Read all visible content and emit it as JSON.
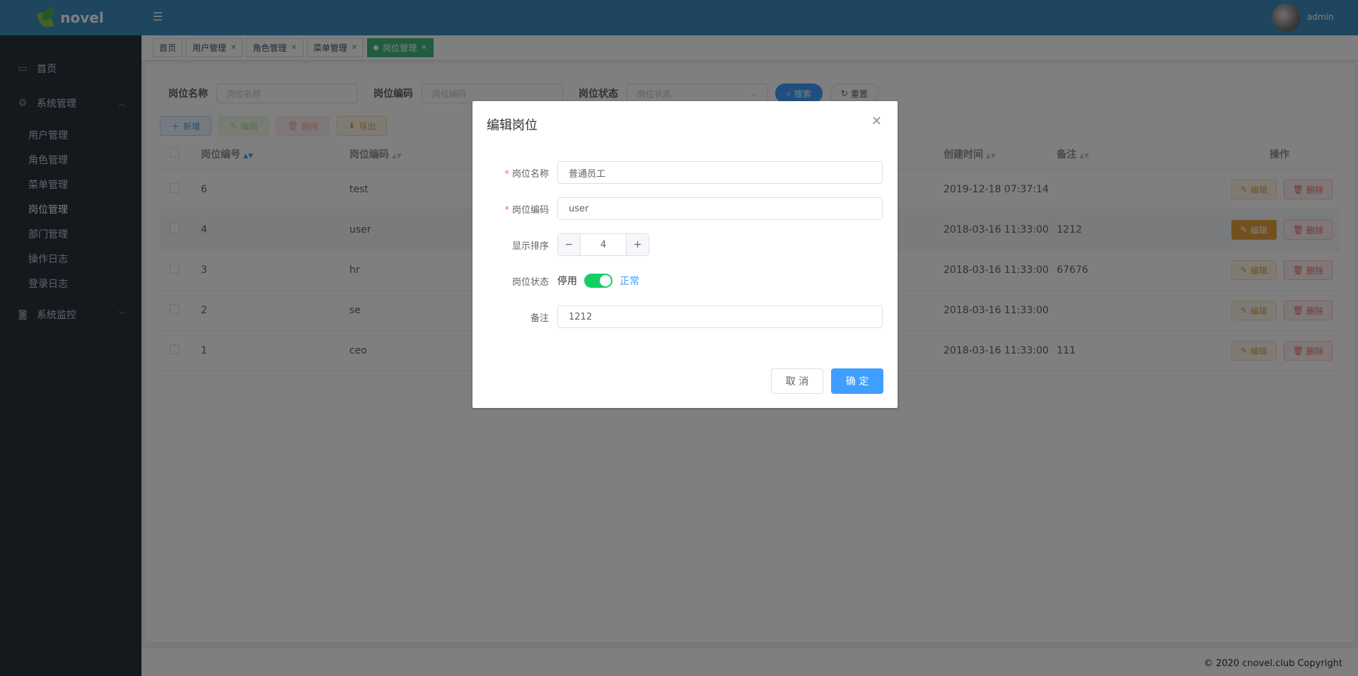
{
  "brand": {
    "name": "novel"
  },
  "sidebar": {
    "items": [
      {
        "label": "首页",
        "icon": "monitor-icon"
      },
      {
        "label": "系统管理",
        "icon": "gears-icon",
        "expanded": true,
        "children": [
          "用户管理",
          "角色管理",
          "菜单管理",
          "岗位管理",
          "部门管理",
          "操作日志",
          "登录日志"
        ],
        "active_child": "岗位管理"
      },
      {
        "label": "系统监控",
        "icon": "camera-icon",
        "expanded": false
      }
    ]
  },
  "header": {
    "username": "admin"
  },
  "tags": [
    {
      "label": "首页",
      "closable": false,
      "active": false
    },
    {
      "label": "用户管理",
      "closable": true,
      "active": false
    },
    {
      "label": "角色管理",
      "closable": true,
      "active": false
    },
    {
      "label": "菜单管理",
      "closable": true,
      "active": false
    },
    {
      "label": "岗位管理",
      "closable": true,
      "active": true
    }
  ],
  "search": {
    "post_name_label": "岗位名称",
    "post_name_placeholder": "岗位名称",
    "post_code_label": "岗位编码",
    "post_code_placeholder": "岗位编码",
    "status_label": "岗位状态",
    "status_placeholder": "岗位状态",
    "search_button": "搜索",
    "reset_button": "重置"
  },
  "toolbar": {
    "add": "新增",
    "edit": "编辑",
    "delete": "删除",
    "export": "导出"
  },
  "table": {
    "columns": [
      "岗位编号",
      "岗位编码",
      "创建时间",
      "备注",
      "操作"
    ],
    "rows": [
      {
        "id": "6",
        "code": "test",
        "created": "2019-12-18 07:37:14",
        "remark": ""
      },
      {
        "id": "4",
        "code": "user",
        "created": "2018-03-16 11:33:00",
        "remark": "1212"
      },
      {
        "id": "3",
        "code": "hr",
        "created": "2018-03-16 11:33:00",
        "remark": "67676"
      },
      {
        "id": "2",
        "code": "se",
        "created": "2018-03-16 11:33:00",
        "remark": ""
      },
      {
        "id": "1",
        "code": "ceo",
        "created": "2018-03-16 11:33:00",
        "remark": "111"
      }
    ],
    "edit_label": "编辑",
    "delete_label": "删除"
  },
  "dialog": {
    "title": "编辑岗位",
    "post_name_label": "岗位名称",
    "post_name_value": "普通员工",
    "post_code_label": "岗位编码",
    "post_code_value": "user",
    "sort_label": "显示排序",
    "sort_value": "4",
    "status_label": "岗位状态",
    "status_off": "停用",
    "status_on": "正常",
    "status_checked": true,
    "remark_label": "备注",
    "remark_value": "1212",
    "cancel": "取 消",
    "confirm": "确 定"
  },
  "footer": {
    "copyright": "© 2020 cnovel.club Copyright"
  },
  "colors": {
    "primary": "#409eff",
    "header": "#3c8dbc",
    "sidebar": "#263238",
    "tag_active": "#42b983",
    "switch_on": "#13ce66",
    "warning": "#e6a23c",
    "danger": "#f56c6c"
  }
}
